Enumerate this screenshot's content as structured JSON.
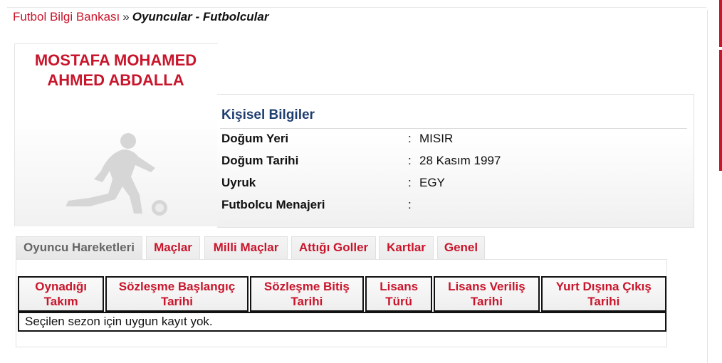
{
  "breadcrumb": {
    "home": "Futbol Bilgi Bankası",
    "separator": "»",
    "current": "Oyuncular - Futbolcular"
  },
  "player": {
    "name_line1": "MOSTAFA MOHAMED",
    "name_line2": "AHMED ABDALLA",
    "photo_icon": "player-silhouette-icon"
  },
  "personal_info": {
    "title": "Kişisel Bilgiler",
    "rows": [
      {
        "label": "Doğum Yeri",
        "colon": ":",
        "value": "MISIR"
      },
      {
        "label": "Doğum Tarihi",
        "colon": ":",
        "value": "28 Kasım 1997"
      },
      {
        "label": "Uyruk",
        "colon": ":",
        "value": "EGY"
      },
      {
        "label": "Futbolcu Menajeri",
        "colon": ":",
        "value": ""
      }
    ]
  },
  "tabs": [
    {
      "label": "Oyuncu Hareketleri",
      "active": true
    },
    {
      "label": "Maçlar",
      "active": false
    },
    {
      "label": "Milli Maçlar",
      "active": false
    },
    {
      "label": "Attığı Goller",
      "active": false
    },
    {
      "label": "Kartlar",
      "active": false
    },
    {
      "label": "Genel",
      "active": false
    }
  ],
  "table": {
    "headers": [
      {
        "line1": "Oynadığı",
        "line2": "Takım"
      },
      {
        "line1": "Sözleşme Başlangıç",
        "line2": "Tarihi"
      },
      {
        "line1": "Sözleşme Bitiş",
        "line2": "Tarihi"
      },
      {
        "line1": "Lisans",
        "line2": "Türü"
      },
      {
        "line1": "Lisans Veriliş",
        "line2": "Tarihi"
      },
      {
        "line1": "Yurt Dışına Çıkış",
        "line2": "Tarihi"
      }
    ],
    "empty_message": "Seçilen sezon için uygun kayıt yok."
  },
  "colors": {
    "accent_red": "#c9152b",
    "info_title_blue": "#1f3e70",
    "inactive_tab_text": "#666666"
  }
}
